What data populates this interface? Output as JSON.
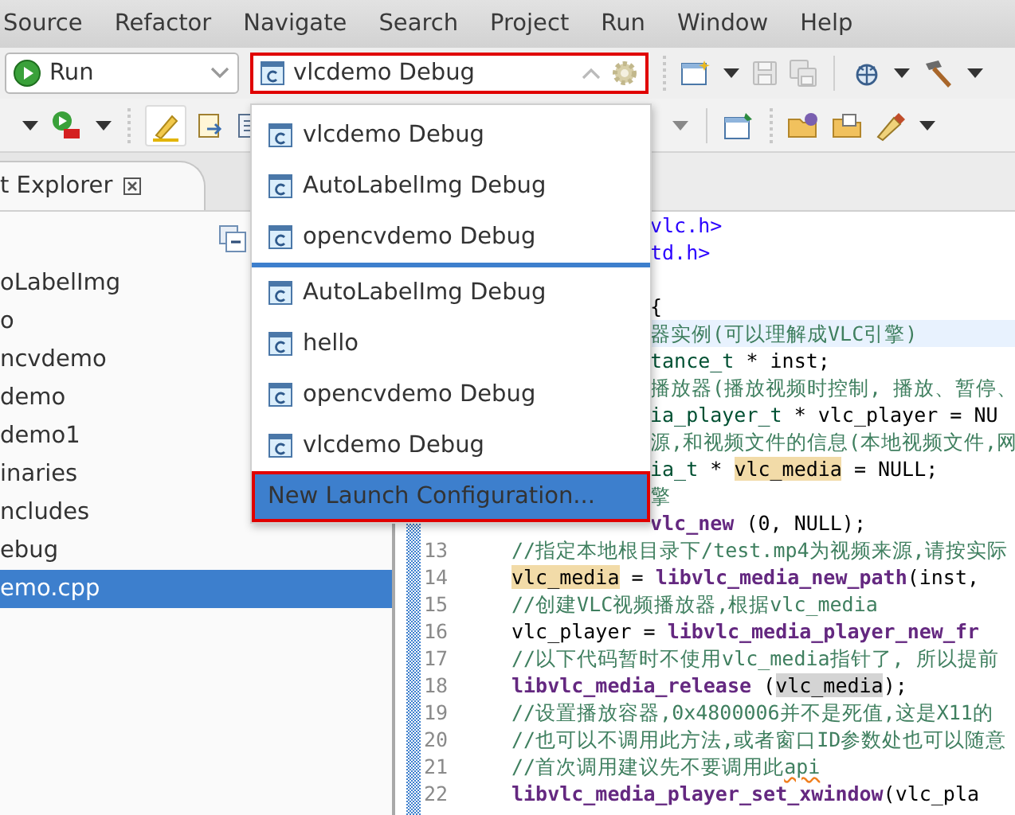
{
  "menu_bar": [
    "Source",
    "Refactor",
    "Navigate",
    "Search",
    "Project",
    "Run",
    "Window",
    "Help"
  ],
  "toolbar": {
    "launch_mode": "Run",
    "launch_config": "vlcdemo Debug",
    "launch_config_outlined": true,
    "mark_occurrences_on": true
  },
  "launch_menu": {
    "items": [
      {
        "kind": "config",
        "label": "vlcdemo Debug",
        "selected": false,
        "outlined": false
      },
      {
        "kind": "config",
        "label": "AutoLabelImg Debug",
        "selected": false,
        "outlined": false
      },
      {
        "kind": "config",
        "label": "opencvdemo Debug",
        "selected": false,
        "outlined": false
      },
      {
        "kind": "separator"
      },
      {
        "kind": "config",
        "label": "AutoLabelImg Debug",
        "selected": false,
        "outlined": false
      },
      {
        "kind": "config",
        "label": "hello",
        "selected": false,
        "outlined": false
      },
      {
        "kind": "config",
        "label": "opencvdemo Debug",
        "selected": false,
        "outlined": false
      },
      {
        "kind": "config",
        "label": "vlcdemo Debug",
        "selected": false,
        "outlined": false
      },
      {
        "kind": "action",
        "label": "New Launch Configuration...",
        "selected": true,
        "outlined": true
      }
    ]
  },
  "explorer": {
    "tab_title": "t Explorer",
    "items": [
      {
        "label": "oLabelImg",
        "selected": false
      },
      {
        "label": "o",
        "selected": false
      },
      {
        "label": "ncvdemo",
        "selected": false
      },
      {
        "label": "demo",
        "selected": false
      },
      {
        "label": "demo1",
        "selected": false
      },
      {
        "label": "inaries",
        "selected": false
      },
      {
        "label": "ncludes",
        "selected": false
      },
      {
        "label": "ebug",
        "selected": false
      },
      {
        "label": "emo.cpp",
        "selected": true
      }
    ]
  },
  "editor": {
    "lines": [
      {
        "current": false,
        "tokens": [
          {
            "kind": "string",
            "text": "vlc.h>"
          }
        ]
      },
      {
        "current": false,
        "tokens": [
          {
            "kind": "string",
            "text": "td.h>"
          }
        ]
      },
      {
        "current": false
      },
      {
        "current": false,
        "tokens": [
          {
            "kind": "plain",
            "text": "{"
          }
        ]
      },
      {
        "current": true,
        "tokens": [
          {
            "kind": "comment",
            "text": "器实例(可以理解成VLC引擎)"
          }
        ]
      },
      {
        "current": false,
        "tokens": [
          {
            "kind": "type",
            "text": "tance_t"
          },
          {
            "kind": "plain",
            "text": " * inst;"
          }
        ]
      },
      {
        "current": false,
        "tokens": [
          {
            "kind": "comment",
            "text": "播放器(播放视频时控制, 播放、暂停、"
          }
        ]
      },
      {
        "current": false,
        "tokens": [
          {
            "kind": "type",
            "text": "ia_player_t"
          },
          {
            "kind": "plain",
            "text": " * vlc_player = NU"
          }
        ]
      },
      {
        "current": false,
        "tokens": [
          {
            "kind": "comment",
            "text": "源,和视频文件的信息(本地视频文件,网"
          }
        ]
      },
      {
        "current": false,
        "tokens": [
          {
            "kind": "type",
            "text": "ia_t"
          },
          {
            "kind": "plain",
            "text": " * "
          },
          {
            "kind": "write",
            "text": "vlc_media"
          },
          {
            "kind": "plain",
            "text": " = NULL;"
          }
        ]
      },
      {
        "current": false,
        "tokens": [
          {
            "kind": "comment",
            "text": "擎"
          }
        ]
      },
      {
        "current": false,
        "tokens": [
          {
            "kind": "function",
            "text": "vlc_new"
          },
          {
            "kind": "plain",
            "text": " (0, NULL);"
          }
        ]
      },
      {
        "number": "13",
        "current": false,
        "tokens": [
          {
            "kind": "comment",
            "text": "//指定本地根目录下/test.mp4为视频来源,请按实际"
          }
        ]
      },
      {
        "number": "14",
        "current": false,
        "tokens": [
          {
            "kind": "write",
            "text": "vlc_media"
          },
          {
            "kind": "plain",
            "text": " = "
          },
          {
            "kind": "function",
            "text": "libvlc_media_new_path"
          },
          {
            "kind": "plain",
            "text": "(inst,"
          }
        ]
      },
      {
        "number": "15",
        "current": false,
        "tokens": [
          {
            "kind": "comment",
            "text": "//创建VLC视频播放器,根据vlc_media"
          }
        ]
      },
      {
        "number": "16",
        "current": false,
        "tokens": [
          {
            "kind": "plain",
            "text": "vlc_player = "
          },
          {
            "kind": "function",
            "text": "libvlc_media_player_new_fr"
          }
        ]
      },
      {
        "number": "17",
        "current": false,
        "tokens": [
          {
            "kind": "comment",
            "text": "//以下代码暂时不使用vlc_media指针了, 所以提前"
          }
        ]
      },
      {
        "number": "18",
        "current": false,
        "tokens": [
          {
            "kind": "function",
            "text": "libvlc_media_release"
          },
          {
            "kind": "plain",
            "text": " ("
          },
          {
            "kind": "read",
            "text": "vlc_media"
          },
          {
            "kind": "plain",
            "text": ");"
          }
        ]
      },
      {
        "number": "19",
        "current": false,
        "tokens": [
          {
            "kind": "comment",
            "text": "//设置播放容器,0x4800006并不是死值,这是X11的"
          }
        ]
      },
      {
        "number": "20",
        "current": false,
        "tokens": [
          {
            "kind": "comment",
            "text": "//也可以不调用此方法,或者窗口ID参数处也可以随意"
          }
        ]
      },
      {
        "number": "21",
        "current": false,
        "tokens": [
          {
            "kind": "comment",
            "text": "//首次调用建议先不要调用此"
          },
          {
            "kind": "misspelled",
            "text": "api"
          }
        ]
      },
      {
        "number": "22",
        "current": false,
        "tokens": [
          {
            "kind": "function",
            "text": "libvlc_media_player_set_xwindow"
          },
          {
            "kind": "plain",
            "text": "(vlc_pla"
          }
        ]
      }
    ]
  }
}
